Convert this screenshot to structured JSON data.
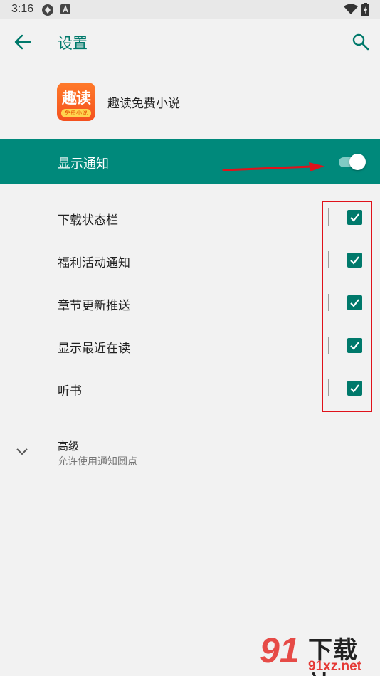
{
  "status_bar": {
    "time": "3:16"
  },
  "app_bar": {
    "title": "设置"
  },
  "app": {
    "name": "趣读免费小说",
    "icon_main": "趣读",
    "icon_sub": "免费小说",
    "icon_color": "#f4511e"
  },
  "notify": {
    "label": "显示通知",
    "enabled": true,
    "bar_color": "#00897b"
  },
  "channels": [
    {
      "label": "下载状态栏",
      "checked": true
    },
    {
      "label": "福利活动通知",
      "checked": true
    },
    {
      "label": "章节更新推送",
      "checked": true
    },
    {
      "label": "显示最近在读",
      "checked": true
    },
    {
      "label": "听书",
      "checked": true
    }
  ],
  "advanced": {
    "title": "高级",
    "subtitle": "允许使用通知圆点"
  },
  "watermark": {
    "text": "下载站",
    "url": "91xz.net",
    "number": "91"
  },
  "colors": {
    "accent": "#00796b",
    "annotation": "#e0121b"
  }
}
